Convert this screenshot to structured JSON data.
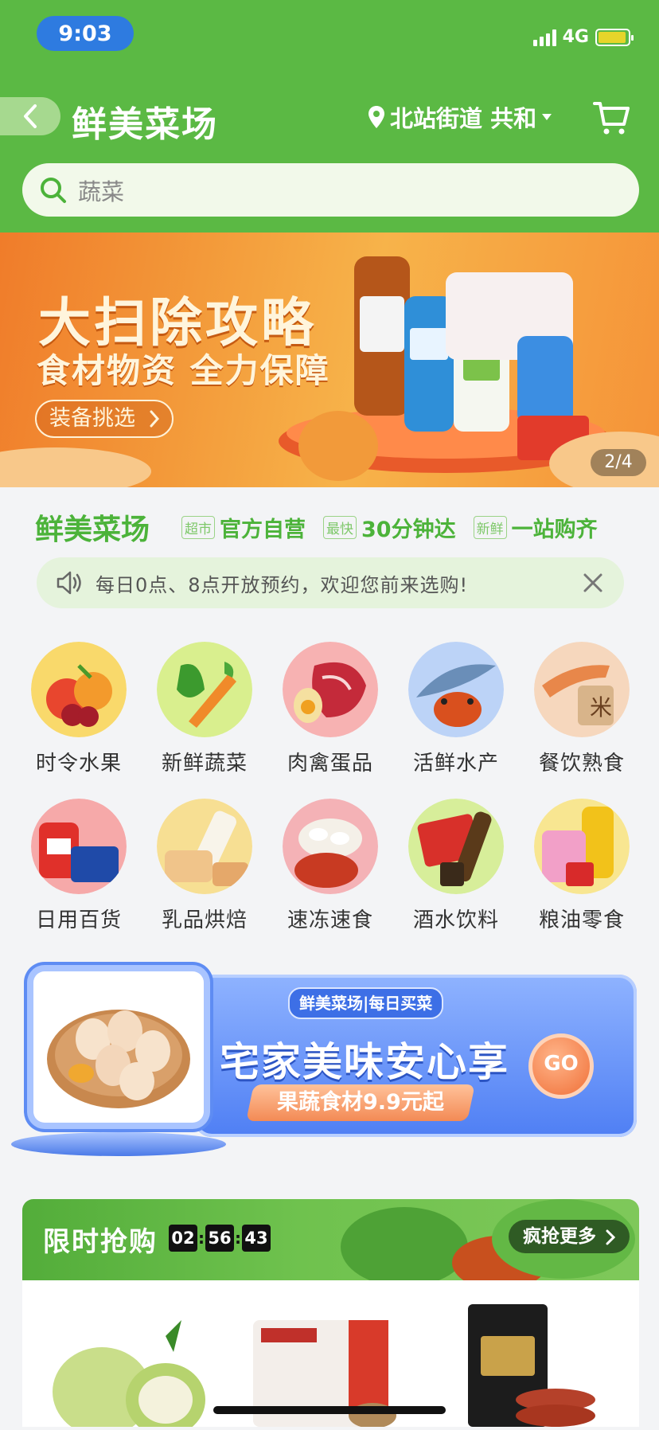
{
  "status_bar": {
    "time": "9:03",
    "network": "4G"
  },
  "header": {
    "title": "鲜美菜场",
    "location": "北站街道 共和",
    "search_placeholder": "蔬菜"
  },
  "banner": {
    "title": "大扫除攻略",
    "subtitle": "食材物资 全力保障",
    "button": "装备挑选",
    "indicator": "2/4"
  },
  "brand": {
    "name": "鲜美菜场",
    "features": [
      {
        "tag": "超市",
        "text": "官方自营"
      },
      {
        "tag": "最快",
        "text": "30分钟达"
      },
      {
        "tag": "新鲜",
        "text": "一站购齐"
      }
    ]
  },
  "notice": {
    "text": "每日0点、8点开放预约，欢迎您前来选购!"
  },
  "categories": [
    {
      "label": "时令水果",
      "color": "#f9d96b"
    },
    {
      "label": "新鲜蔬菜",
      "color": "#d9ef8e"
    },
    {
      "label": "肉禽蛋品",
      "color": "#f7b2b2"
    },
    {
      "label": "活鲜水产",
      "color": "#bcd3f7"
    },
    {
      "label": "餐饮熟食",
      "color": "#f6d7bd"
    },
    {
      "label": "日用百货",
      "color": "#f6a9a9"
    },
    {
      "label": "乳品烘焙",
      "color": "#f7df93"
    },
    {
      "label": "速冻速食",
      "color": "#f4b2b6"
    },
    {
      "label": "酒水饮料",
      "color": "#d7ee9a"
    },
    {
      "label": "粮油零食",
      "color": "#f8e691"
    }
  ],
  "promo": {
    "tag": "鲜美菜场|每日买菜",
    "title": "宅家美味安心享",
    "button": "果蔬食材9.9元起",
    "go": "GO"
  },
  "flash_sale": {
    "title": "限时抢购",
    "timer": [
      "02",
      "56",
      "43"
    ],
    "more": "疯抢更多"
  },
  "colors": {
    "brand_green": "#5bb944",
    "accent_blue": "#2e7be0"
  }
}
